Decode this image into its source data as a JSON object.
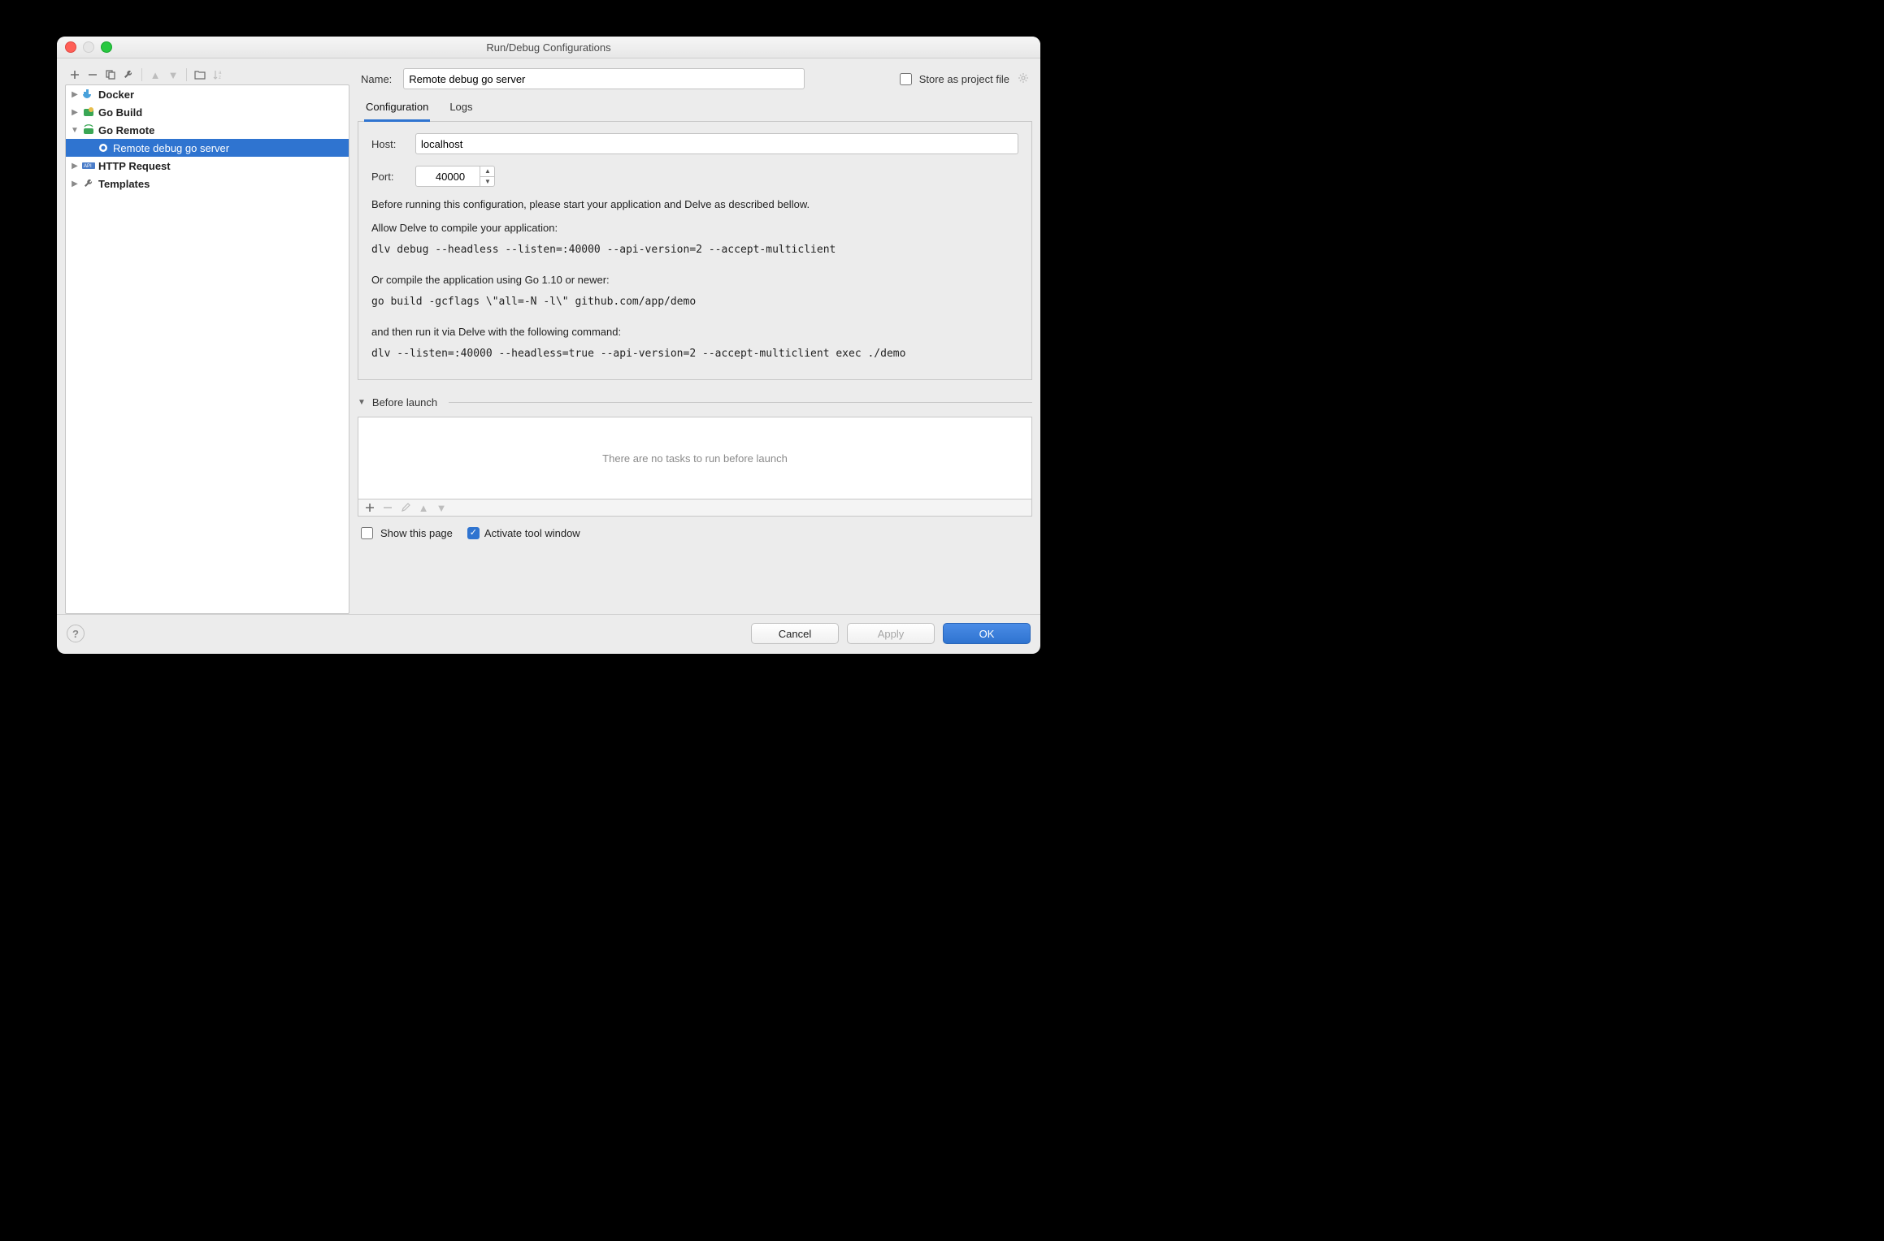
{
  "title": "Run/Debug Configurations",
  "sidebar": {
    "items": [
      {
        "label": "Docker",
        "expanded": false
      },
      {
        "label": "Go Build",
        "expanded": false
      },
      {
        "label": "Go Remote",
        "expanded": true
      },
      {
        "label": "HTTP Request",
        "expanded": false
      },
      {
        "label": "Templates",
        "expanded": false
      }
    ],
    "child_label": "Remote debug go server"
  },
  "header": {
    "name_label": "Name:",
    "name_value": "Remote debug go server",
    "store_label": "Store as project file"
  },
  "tabs": {
    "configuration": "Configuration",
    "logs": "Logs"
  },
  "config": {
    "host_label": "Host:",
    "host_value": "localhost",
    "port_label": "Port:",
    "port_value": "40000",
    "desc1": "Before running this configuration, please start your application and Delve as described bellow.",
    "desc2": "Allow Delve to compile your application:",
    "cmd1": "dlv debug --headless --listen=:40000 --api-version=2 --accept-multiclient",
    "desc3": "Or compile the application using Go 1.10 or newer:",
    "cmd2": "go build -gcflags \\\"all=-N -l\\\" github.com/app/demo",
    "desc4": "and then run it via Delve with the following command:",
    "cmd3": "dlv --listen=:40000 --headless=true --api-version=2 --accept-multiclient exec ./demo"
  },
  "before_launch": {
    "title": "Before launch",
    "empty": "There are no tasks to run before launch",
    "show_page": "Show this page",
    "activate_tool": "Activate tool window"
  },
  "footer": {
    "cancel": "Cancel",
    "apply": "Apply",
    "ok": "OK"
  }
}
